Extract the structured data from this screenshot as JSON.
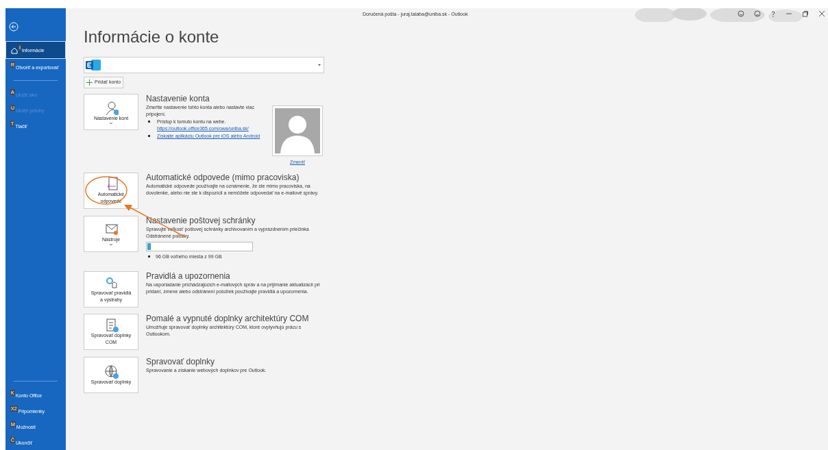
{
  "window": {
    "title": "Doručená pošta - juraj.talaba@uniba.sk  -  Outlook"
  },
  "sidebar": {
    "items": [
      {
        "label": "Informácie",
        "keytip": "I",
        "selected": true,
        "disabled": false
      },
      {
        "label": "Otvoriť a exportovať",
        "keytip": "R",
        "selected": false,
        "disabled": false
      },
      {
        "label": "Uložiť ako",
        "keytip": "A",
        "selected": false,
        "disabled": true
      },
      {
        "label": "Uložiť prílohy",
        "keytip": "U",
        "selected": false,
        "disabled": true
      },
      {
        "label": "Tlačiť",
        "keytip": "T",
        "selected": false,
        "disabled": false
      }
    ],
    "bottom_items": [
      {
        "label": "Konto Office",
        "keytip": "K",
        "selected": false,
        "disabled": false
      },
      {
        "label": "Pripomienky",
        "keytip": "X2",
        "selected": false,
        "disabled": false
      },
      {
        "label": "Možnosti",
        "keytip": "M",
        "selected": false,
        "disabled": false
      },
      {
        "label": "Ukončiť",
        "keytip": "Č",
        "selected": false,
        "disabled": false
      }
    ]
  },
  "page_title": "Informácie o konte",
  "add_account": "Pridať konto",
  "sections": [
    {
      "kind": "account",
      "button": "Nastavenie kont",
      "dropdown": true,
      "title": "Nastavenie konta",
      "text": "Zmeňte nastavenie tohto konta alebo nastavte viac pripojení.",
      "bullets": [
        {
          "text": "Prístup k tomuto kontu na webe.",
          "link": "https://outlook.office365.com/owa/uniba.sk/"
        },
        {
          "link": "Získajte aplikáciu Outlook pre iOS alebo Android"
        }
      ],
      "photo_link": "Zmeniť"
    },
    {
      "kind": "plain",
      "button": "Automatické odpovede",
      "dropdown": false,
      "title": "Automatické odpovede (mimo pracoviska)",
      "text": "Automatické odpovede používajte na oznámenie, že ste mimo pracoviska, na dovolenke, alebo nie ste k dispozícii a nemôžete odpovedať na e-mailové správy."
    },
    {
      "kind": "storage",
      "button": "Nástroje",
      "dropdown": true,
      "title": "Nastavenie poštovej schránky",
      "text": "Spravujte veľkosť poštovej schránky archivovaním a vyprázdnením priečinka Odstránené položky.",
      "level": 0.03,
      "reading": "96 GB voľného miesta z 99 GB"
    },
    {
      "kind": "plain",
      "button": "Spravovať pravidlá a výstrahy",
      "dropdown": false,
      "title": "Pravidlá a upozornenia",
      "text": "Na usporiadanie prichádzajúcich e-mailových správ a na prijímanie aktualizácií pri pridaní, zmene alebo odstránení položiek používajte pravidlá a upozornenia."
    },
    {
      "kind": "plain",
      "button": "Spravovať doplnky COM",
      "dropdown": false,
      "title": "Pomalé a vypnuté doplnky architektúry COM",
      "text": "Umožňuje spravovať doplnky architektúry COM, ktoré ovplyvňujú prácu s Outlookom."
    },
    {
      "kind": "plain",
      "button": "Spravovať doplnky",
      "dropdown": false,
      "title": "Spravovať doplnky",
      "text": "Spravovanie a získanie webových doplnkov pre Outlook."
    }
  ]
}
